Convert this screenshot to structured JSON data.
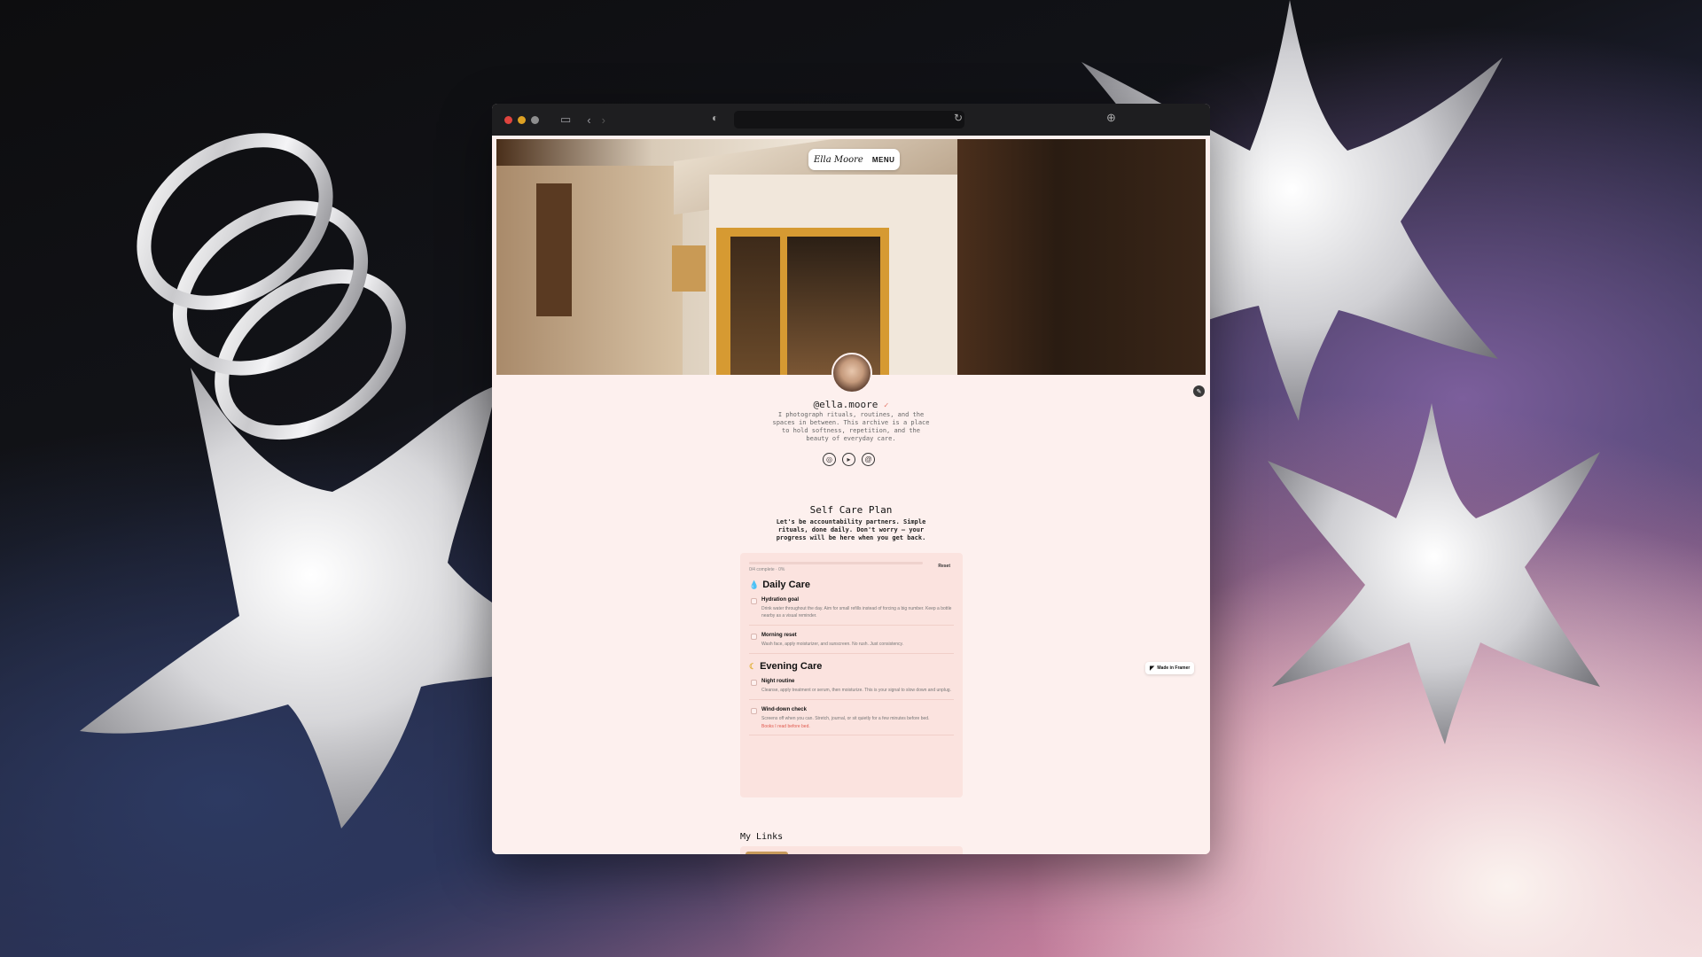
{
  "colors": {
    "accent": "#e3786a",
    "page_bg": "#fdf0ee",
    "card_bg": "#fbe3df",
    "toolbar": "#1e1e20",
    "traffic_red": "#e0443e",
    "traffic_yellow": "#dea123",
    "traffic_green": "#8e8e8e"
  },
  "toolbar": {
    "icons": [
      "sidebar-icon",
      "back-icon",
      "forward-icon",
      "shield-icon",
      "reload-icon",
      "download-icon"
    ]
  },
  "nav": {
    "brand": "Ella Moore",
    "menu_label": "MENU"
  },
  "profile": {
    "handle": "@ella.moore",
    "bio": "I photograph rituals, routines, and the spaces in between. This archive is a place to hold softness, repetition, and the beauty of everyday care.",
    "socials": [
      "instagram-icon",
      "youtube-icon",
      "threads-icon"
    ]
  },
  "plan": {
    "title": "Self Care Plan",
    "subtitle": "Let's be accountability partners. Simple rituals, done daily. Don't worry — your progress will be here when you get back.",
    "progress_text": "0/4 complete · 0%",
    "progress_value": 0,
    "reset_label": "Reset",
    "sections": [
      {
        "title": "Daily Care",
        "icon": "water-drop-icon",
        "items": [
          {
            "title": "Hydration goal",
            "desc": "Drink water throughout the day. Aim for small refills instead of forcing a big number. Keep a bottle nearby as a visual reminder."
          },
          {
            "title": "Morning reset",
            "desc": "Wash face, apply moisturizer, and sunscreen. No rush. Just consistency."
          }
        ]
      },
      {
        "title": "Evening Care",
        "icon": "moon-icon",
        "items": [
          {
            "title": "Night routine",
            "desc": "Cleanse, apply treatment or serum, then moisturize. This is your signal to slow down and unplug."
          },
          {
            "title": "Wind-down check",
            "desc": "Screens off when you can. Stretch, journal, or sit quietly for a few minutes before bed.",
            "link": "Books I read before bed."
          }
        ]
      }
    ]
  },
  "links": {
    "title": "My Links"
  },
  "badge": {
    "label": "Made in Framer"
  }
}
